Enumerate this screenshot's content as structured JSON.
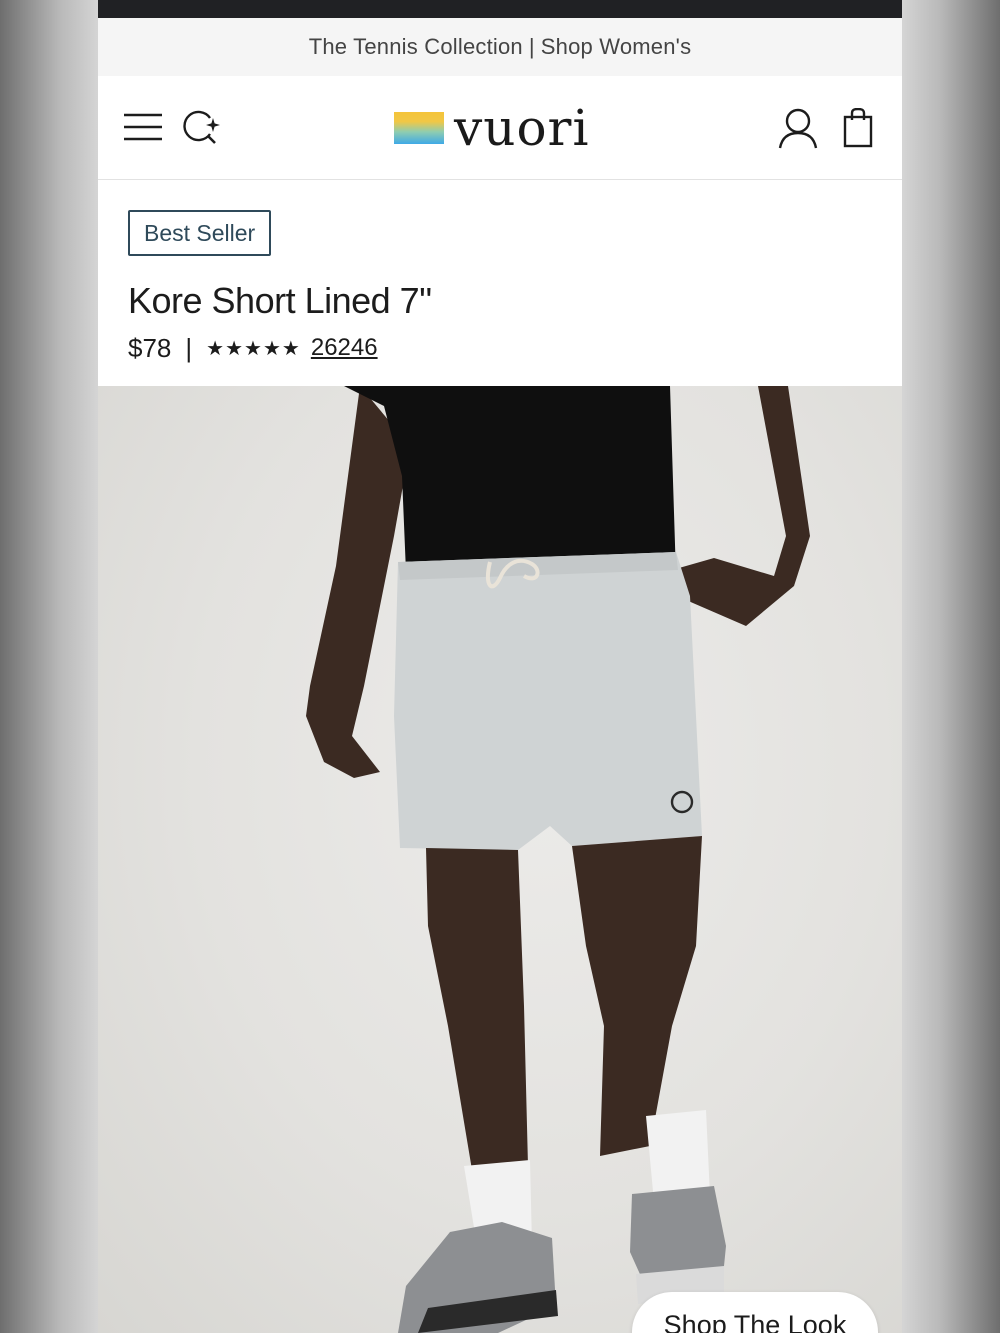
{
  "promo": {
    "left_link": "The Tennis Collection",
    "separator": "|",
    "right_link": "Shop Women's"
  },
  "header": {
    "logo_text": "vuori",
    "icons": [
      "menu-icon",
      "search-sparkle-icon",
      "account-icon",
      "shopping-bag-icon"
    ]
  },
  "product": {
    "badge": "Best Seller",
    "title": "Kore Short Lined 7\"",
    "price": "$78",
    "divider": "|",
    "rating_stars": 5,
    "review_count": "26246"
  },
  "gallery": {
    "shop_the_look_label": "Shop The Look"
  },
  "colors": {
    "top_bar": "#202124",
    "promo_bg": "#f5f5f5",
    "badge_border": "#2f4a5a",
    "text": "#1c1c1c"
  }
}
